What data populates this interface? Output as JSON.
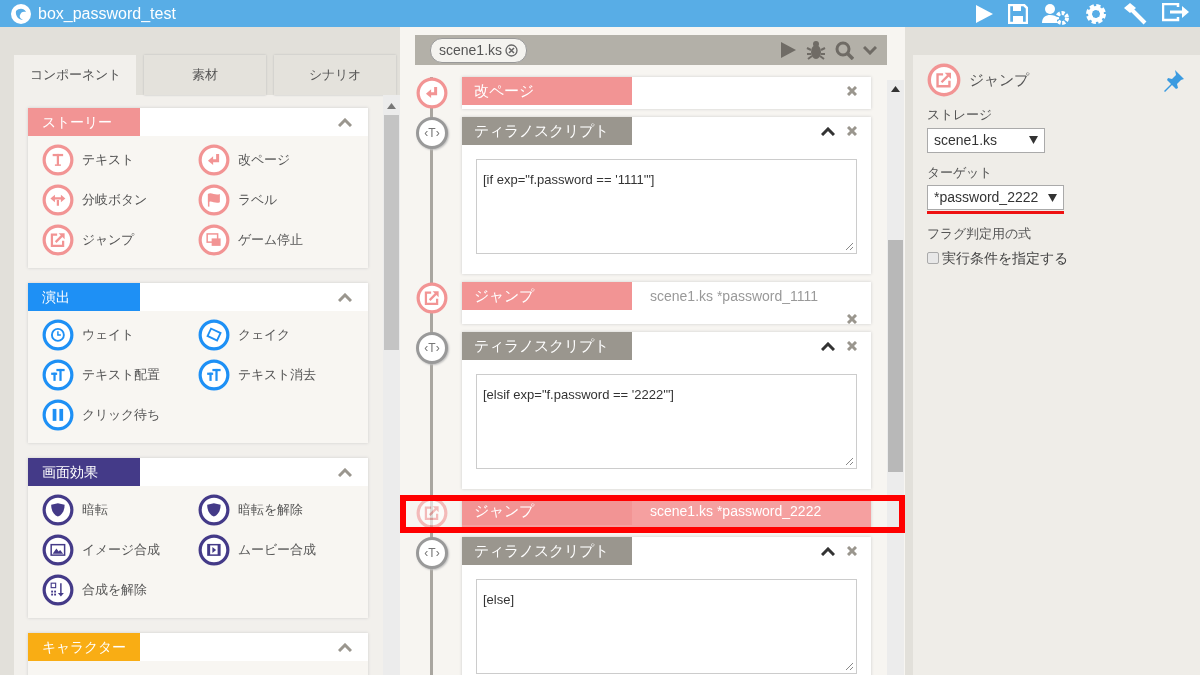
{
  "window": {
    "title": "box_password_test"
  },
  "left_panel": {
    "tabs": [
      {
        "label": "コンポーネント",
        "selected": true
      },
      {
        "label": "素材",
        "selected": false
      },
      {
        "label": "シナリオ",
        "selected": false
      }
    ],
    "sections": [
      {
        "title": "ストーリー",
        "color": "#f29494",
        "expanded": true,
        "items": [
          {
            "label": "テキスト",
            "kind": "text"
          },
          {
            "label": "改ページ",
            "kind": "page_break"
          },
          {
            "label": "分岐ボタン",
            "kind": "branch"
          },
          {
            "label": "ラベル",
            "kind": "label"
          },
          {
            "label": "ジャンプ",
            "kind": "jump"
          },
          {
            "label": "ゲーム停止",
            "kind": "stop"
          }
        ]
      },
      {
        "title": "演出",
        "color": "#1e90f5",
        "expanded": true,
        "items": [
          {
            "label": "ウェイト",
            "kind": "wait"
          },
          {
            "label": "クェイク",
            "kind": "shake"
          },
          {
            "label": "テキスト配置",
            "kind": "text_place"
          },
          {
            "label": "テキスト消去",
            "kind": "text_clear"
          },
          {
            "label": "クリック待ち",
            "kind": "click_wait"
          }
        ]
      },
      {
        "title": "画面効果",
        "color": "#443a88",
        "expanded": true,
        "items": [
          {
            "label": "暗転",
            "kind": "fade"
          },
          {
            "label": "暗転を解除",
            "kind": "fade"
          },
          {
            "label": "イメージ合成",
            "kind": "image"
          },
          {
            "label": "ムービー合成",
            "kind": "movie"
          },
          {
            "label": "合成を解除",
            "kind": "clear_comp"
          }
        ]
      },
      {
        "title": "キャラクター",
        "color": "#f9ad14",
        "expanded": true
      }
    ]
  },
  "scenario": {
    "file_tab": "scene1.ks",
    "entries": [
      {
        "kind": "page_break",
        "label": "改ページ"
      },
      {
        "kind": "script",
        "label": "ティラノスクリプト",
        "icon_glyph": "‹T›",
        "expanded": true,
        "code": "[if exp=\"f.password == '1111'\"]"
      },
      {
        "kind": "jump",
        "label": "ジャンプ",
        "target": "scene1.ks *password_1111",
        "selected": false
      },
      {
        "kind": "script",
        "label": "ティラノスクリプト",
        "icon_glyph": "‹T›",
        "expanded": true,
        "code": "[elsif exp=\"f.password == '2222'\"]"
      },
      {
        "kind": "jump",
        "label": "ジャンプ",
        "target": "scene1.ks *password_2222",
        "selected": true
      },
      {
        "kind": "script",
        "label": "ティラノスクリプト",
        "icon_glyph": "‹T›",
        "expanded": true,
        "code": "[else]"
      }
    ]
  },
  "properties": {
    "title": "ジャンプ",
    "fields": [
      {
        "label": "ストレージ",
        "value": "scene1.ks",
        "highlighted": false
      },
      {
        "label": "ターゲット",
        "value": "*password_2222",
        "highlighted": true
      }
    ],
    "expression_label": "フラグ判定用の式",
    "condition": {
      "label": "実行条件を指定する",
      "checked": false
    }
  }
}
